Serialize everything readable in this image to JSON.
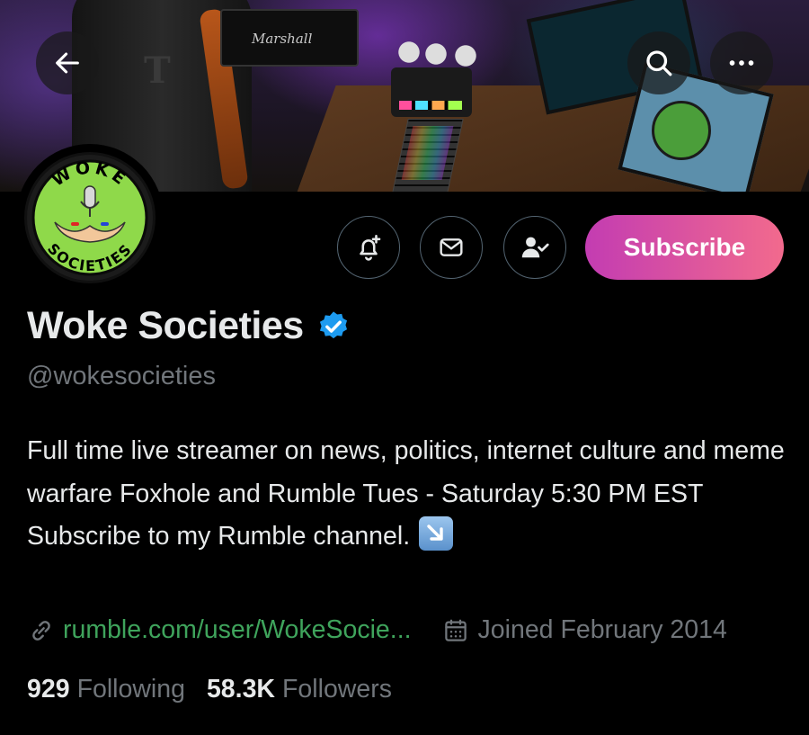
{
  "header": {
    "back_icon": "arrow-left-icon",
    "search_icon": "search-icon",
    "more_icon": "more-horizontal-icon",
    "banner": {
      "amp_brand": "Marshall",
      "chair_logo": "T"
    }
  },
  "avatar": {
    "top_text": "WOKE",
    "bottom_text": "SOCIETIES",
    "colors": {
      "ring": "#1b1b1b",
      "fill": "#8fd94a",
      "text": "#000000"
    }
  },
  "actions": {
    "notify_icon": "bell-plus-icon",
    "message_icon": "envelope-icon",
    "following_icon": "person-check-icon",
    "subscribe_label": "Subscribe"
  },
  "profile": {
    "display_name": "Woke Societies",
    "verified_icon": "verified-badge-icon",
    "handle": "@wokesocieties",
    "bio": "Full time live streamer on news, politics, internet culture and meme warfare Foxhole and Rumble Tues - Saturday 5:30 PM EST Subscribe to my Rumble channel.",
    "bio_emoji": "down-right-arrow-emoji",
    "link": "rumble.com/user/WokeSocie...",
    "joined": "Joined February 2014",
    "link_icon": "link-icon",
    "calendar_icon": "calendar-icon"
  },
  "stats": {
    "following_count": "929",
    "following_label": "Following",
    "followers_count": "58.3K",
    "followers_label": "Followers"
  },
  "colors": {
    "background": "#000000",
    "text_primary": "#e7e9ea",
    "text_secondary": "#71767b",
    "link": "#3fa45c",
    "verified": "#1d9bf0",
    "subscribe_gradient_start": "#c33cb2",
    "subscribe_gradient_end": "#f26a8d"
  }
}
